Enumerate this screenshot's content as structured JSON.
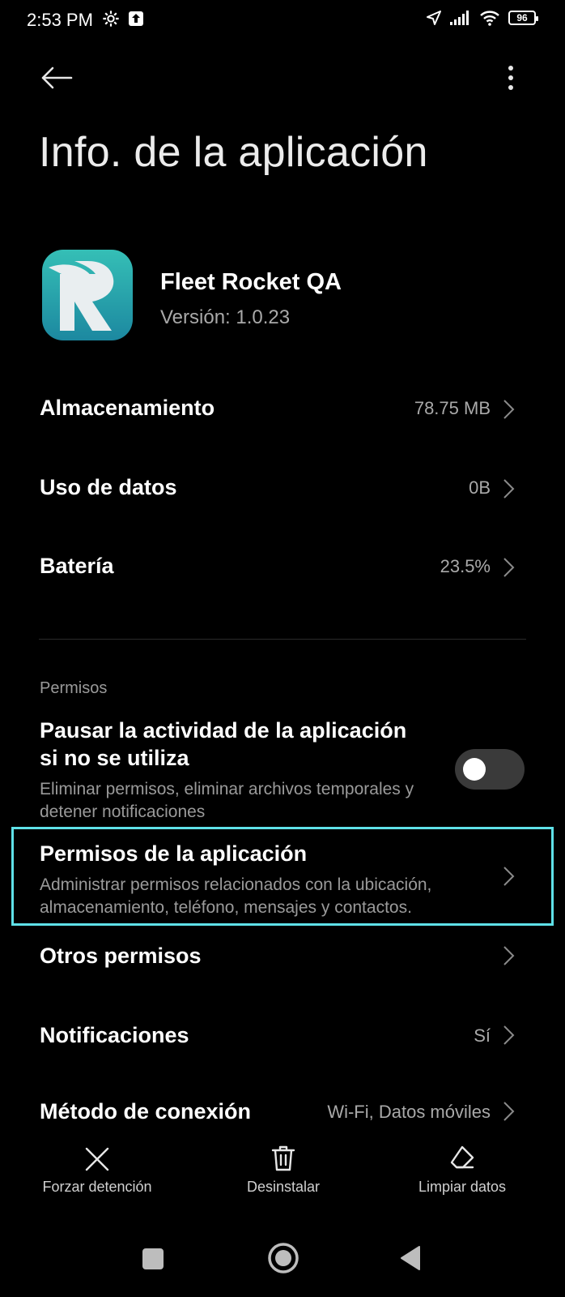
{
  "status_bar": {
    "time": "2:53 PM",
    "left_icons": [
      "settings-icon",
      "upload-icon"
    ],
    "right_icons": [
      "location-icon",
      "signal-icon",
      "wifi-icon",
      "battery-icon"
    ],
    "battery_level": "96"
  },
  "header": {
    "title": "Info. de la aplicación",
    "back_icon": "arrow-left-icon",
    "menu_icon": "more-vertical-icon"
  },
  "app": {
    "name": "Fleet Rocket QA",
    "version": "Versión: 1.0.23",
    "icon_colors": {
      "top": "#2fb7b4",
      "bottom": "#1f8fa0",
      "letter": "#e9eef0"
    }
  },
  "rows": [
    {
      "title": "Almacenamiento",
      "value": "78.75 MB"
    },
    {
      "title": "Uso de datos",
      "value": "0B"
    },
    {
      "title": "Batería",
      "value": "23.5%"
    }
  ],
  "permissions_section": {
    "label": "Permisos",
    "pause": {
      "title": "Pausar la actividad de la aplicación si no se utiliza",
      "description": "Eliminar permisos, eliminar archivos temporales y detener notificaciones",
      "toggle_on": false
    },
    "app_permissions": {
      "title": "Permisos de la aplicación",
      "description": "Administrar permisos relacionados con la ubicación, almacenamiento, teléfono, mensajes y contactos."
    },
    "other_permissions": {
      "title": "Otros permisos"
    },
    "notifications": {
      "title": "Notificaciones",
      "value": "Sí"
    },
    "connection_method": {
      "title": "Método de conexión",
      "value": "Wi-Fi, Datos móviles"
    }
  },
  "actions": [
    {
      "label": "Forzar detención",
      "icon": "close-icon"
    },
    {
      "label": "Desinstalar",
      "icon": "trash-icon"
    },
    {
      "label": "Limpiar datos",
      "icon": "eraser-icon"
    }
  ],
  "colors": {
    "background": "#000000",
    "highlight_border": "#5fe1e8",
    "secondary_text": "#a9a9a9"
  }
}
